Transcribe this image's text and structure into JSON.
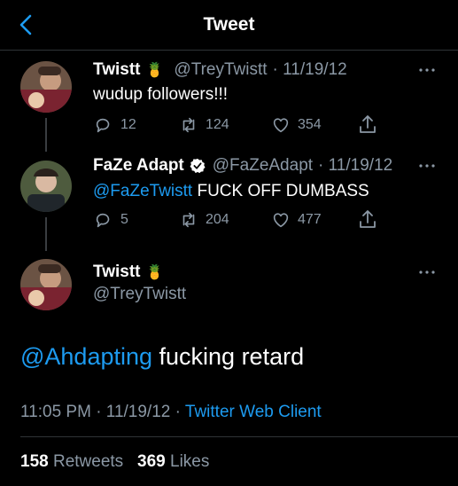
{
  "header": {
    "title": "Tweet"
  },
  "tweets": [
    {
      "name": "Twistt",
      "emoji": "🍍",
      "handle": "@TreyTwistt",
      "date": "· 11/19/12",
      "text": "wudup followers!!!",
      "replies": "12",
      "retweets": "124",
      "likes": "354"
    },
    {
      "name": "FaZe Adapt",
      "handle": "@FaZeAdapt",
      "date": "· 11/19/12",
      "mention": "@FaZeTwistt",
      "text": " FUCK OFF DUMBASS",
      "replies": "5",
      "retweets": "204",
      "likes": "477"
    }
  ],
  "main": {
    "name": "Twistt",
    "emoji": "🍍",
    "handle": "@TreyTwistt",
    "mention": "@Ahdapting",
    "text": " fucking retard",
    "time": "11:05 PM · 11/19/12 · ",
    "client": "Twitter Web Client",
    "retweet_count": "158",
    "retweet_label": "Retweets",
    "like_count": "369",
    "like_label": "Likes"
  },
  "colors": {
    "accent": "#1d9bf0",
    "muted": "#8b98a5",
    "verified": "#ffffff"
  }
}
